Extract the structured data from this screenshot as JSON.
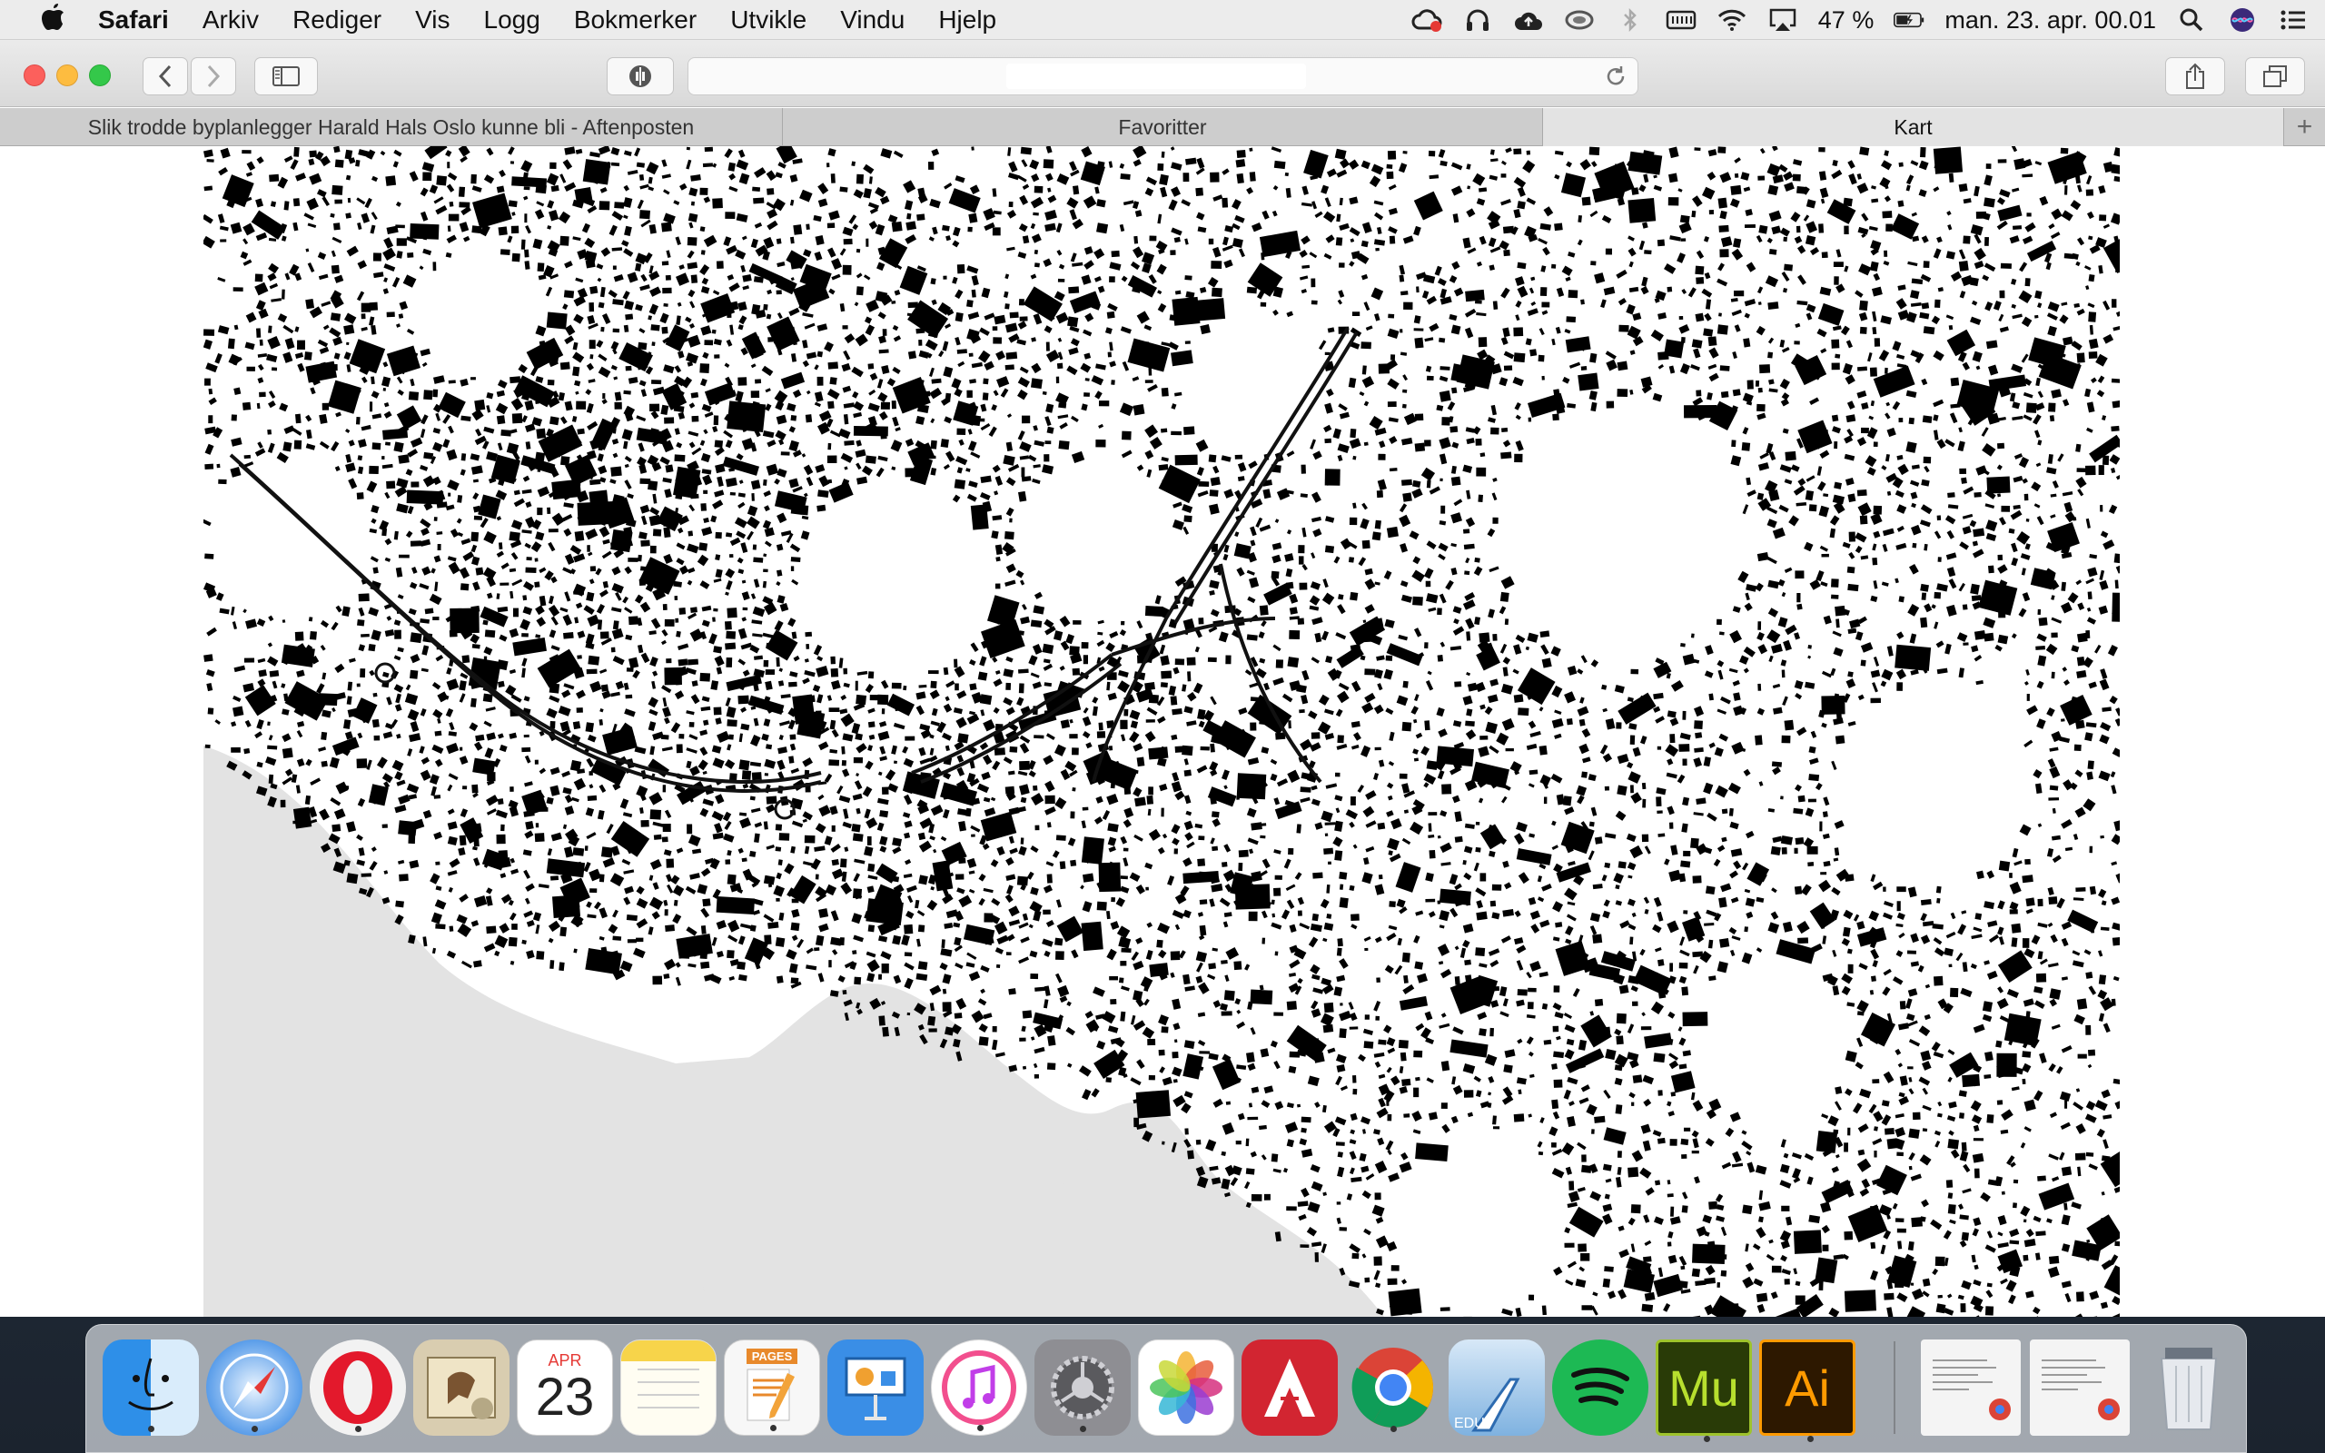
{
  "menubar": {
    "app_name": "Safari",
    "items": [
      "Arkiv",
      "Rediger",
      "Vis",
      "Logg",
      "Bokmerker",
      "Utvikle",
      "Vindu",
      "Hjelp"
    ],
    "battery_percent": "47 %",
    "clock": "man. 23. apr.  00.01",
    "status_icons": [
      "creative-cloud-icon",
      "headphones-icon",
      "cloud-upload-icon",
      "wifi-pulse-icon",
      "bluetooth-icon",
      "keyboard-icon",
      "wifi-icon",
      "airplay-icon",
      "battery-icon",
      "search-icon",
      "siri-icon",
      "notification-center-icon"
    ]
  },
  "toolbar": {
    "buttons": [
      "back-icon",
      "forward-icon",
      "sidebar-icon",
      "privacy-icon",
      "reload-icon",
      "share-icon",
      "tabs-overview-icon"
    ]
  },
  "tabs": [
    {
      "label": "Slik trodde byplanlegger Harald Hals Oslo kunne bli - Aftenposten",
      "active": false
    },
    {
      "label": "Favoritter",
      "active": false
    },
    {
      "label": "Kart",
      "active": true
    }
  ],
  "page": {
    "content": "figure-ground map of Oslo",
    "colors": {
      "buildings": "#000000",
      "water": "#e3e3e3",
      "ground": "#ffffff"
    }
  },
  "dock": {
    "apps": [
      "finder-icon",
      "safari-icon",
      "opera-icon",
      "mail-icon",
      "calendar-icon",
      "notes-icon",
      "pages-icon",
      "keynote-icon",
      "itunes-icon",
      "system-preferences-icon",
      "photos-icon",
      "autocad-icon",
      "chrome-icon",
      "archicad-icon",
      "spotify-icon",
      "muse-icon",
      "illustrator-icon"
    ],
    "calendar_month": "APR",
    "calendar_day": "23",
    "pages_label": "PAGES",
    "archicad_label": "EDU",
    "muse_label": "Mu",
    "illustrator_label": "Ai"
  }
}
